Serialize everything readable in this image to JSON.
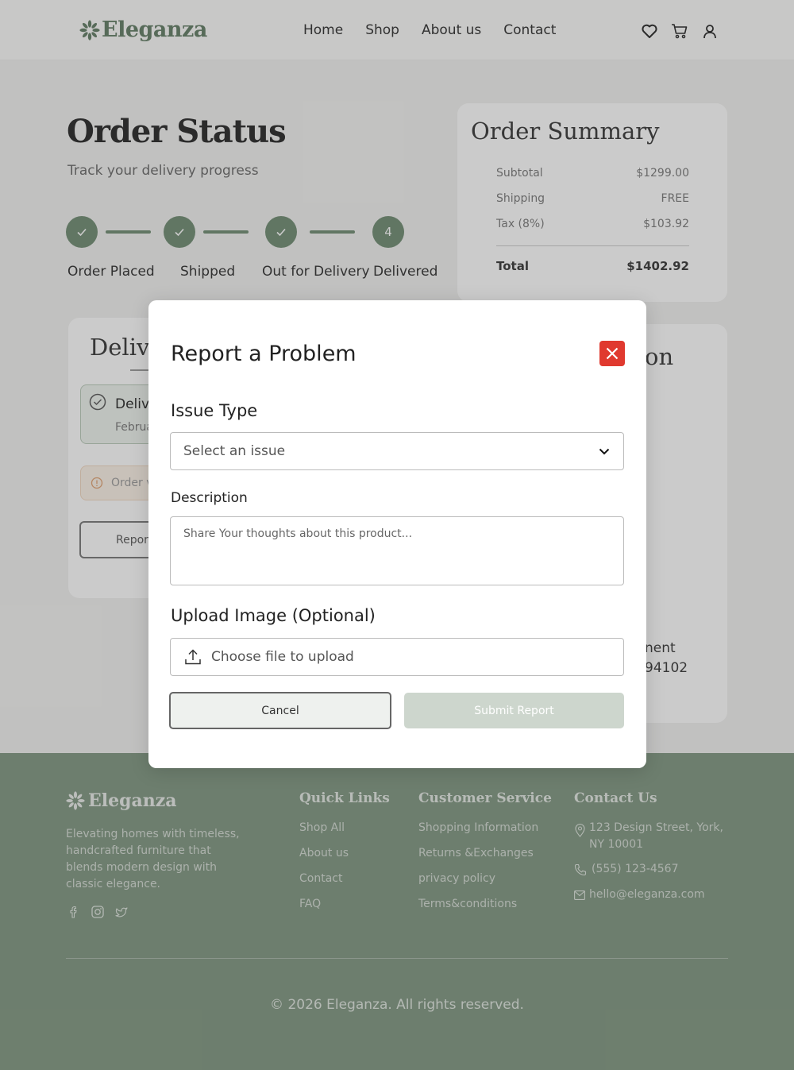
{
  "header": {
    "logo": "Eleganza",
    "nav": [
      "Home",
      "Shop",
      "About us",
      "Contact"
    ],
    "icons": [
      "heart-icon",
      "cart-icon",
      "user-icon"
    ]
  },
  "order_status": {
    "title": "Order Status",
    "subtitle": "Track your delivery progress",
    "steps": [
      {
        "label": "Order Placed",
        "state": "done"
      },
      {
        "label": "Shipped",
        "state": "done"
      },
      {
        "label": "Out for Delivery",
        "state": "done"
      },
      {
        "label": "Delivered",
        "state": "current",
        "number": "4"
      }
    ]
  },
  "summary": {
    "title": "Order Summary",
    "rows": [
      {
        "label": "Subtotal",
        "value": "$1299.00"
      },
      {
        "label": "Shipping",
        "value": "FREE"
      },
      {
        "label": "Tax (8%)",
        "value": "$103.92"
      }
    ],
    "total_label": "Total",
    "total_value": "$1402.92"
  },
  "delivery_card": {
    "title_partial": "Delive",
    "status_partial": "Delive",
    "date_partial": "Februa",
    "warning_partial": "Order v",
    "report_partial": "Repor"
  },
  "shipping_card": {
    "title_tail": "on",
    "line1_tail": "nent",
    "line2_tail": "94102"
  },
  "modal": {
    "title": "Report a Problem",
    "issue_label": "Issue Type",
    "issue_value": "Select an issue",
    "description_label": "Description",
    "description_placeholder": "Share Your thoughts about this product...",
    "upload_label": "Upload Image (Optional)",
    "upload_text": "Choose file to upload",
    "cancel_label": "Cancel",
    "submit_label": "Submit Report"
  },
  "footer": {
    "logo": "Eleganza",
    "description": "Elevating homes with timeless, handcrafted furniture that blends modern design with classic elegance.",
    "quick_links_title": "Quick Links",
    "quick_links": [
      "Shop All",
      "About us",
      "Contact",
      "FAQ"
    ],
    "service_title": "Customer Service",
    "service_links": [
      "Shopping Information",
      "Returns &Exchanges",
      "privacy policy",
      "Terms&conditions"
    ],
    "contact_title": "Contact Us",
    "address_line1": "123 Design Street, York,",
    "address_line2": "NY 10001",
    "phone": "(555) 123-4567",
    "email": "hello@eleganza.com",
    "copyright": "2026 Eleganza. All rights reserved."
  },
  "colors": {
    "accent": "#6d8a6f",
    "footer_bg": "#7d957e",
    "close_button": "#e0392f"
  }
}
